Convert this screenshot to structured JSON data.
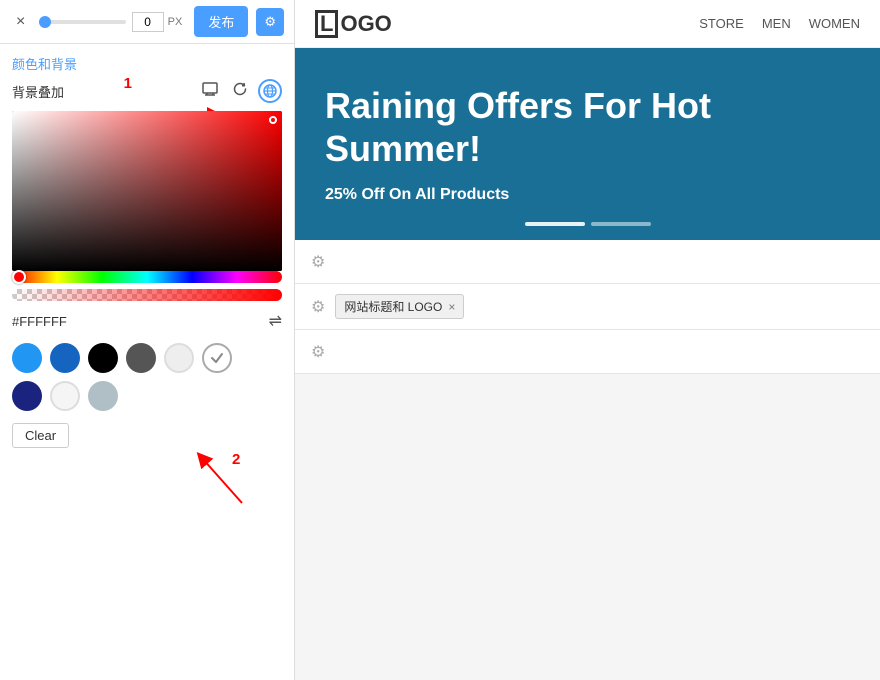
{
  "topbar": {
    "close_label": "×",
    "slider_value": "0",
    "slider_unit": "PX",
    "publish_label": "发布",
    "settings_icon": "⚙"
  },
  "left_panel": {
    "section_title": "颜色和背景",
    "bg_label": "背景叠加",
    "hex_value": "#FFFFFF",
    "clear_label": "Clear",
    "annotation1": "1",
    "annotation2": "2",
    "icons": {
      "monitor": "🖥",
      "refresh": "↺",
      "globe": "🌐"
    },
    "swatches_row1": [
      {
        "color": "#2196f3",
        "selected": false
      },
      {
        "color": "#1565c0",
        "selected": false
      },
      {
        "color": "#000000",
        "selected": false
      },
      {
        "color": "#555555",
        "selected": false
      },
      {
        "color": "#eeeeee",
        "selected": false
      },
      {
        "color": "#ffffff",
        "selected": true,
        "white": true
      }
    ],
    "swatches_row2": [
      {
        "color": "#1a237e",
        "selected": false
      },
      {
        "color": "#f5f5f5",
        "selected": false
      },
      {
        "color": "#b0bec5",
        "selected": false
      }
    ]
  },
  "right_panel": {
    "logo": "LOGO",
    "nav": [
      "STORE",
      "MEN",
      "WOMEN"
    ],
    "hero": {
      "title": "Raining Offers For Hot Summer!",
      "subtitle": "25% Off On All Products"
    },
    "component_tag": "网站标题和 LOGO",
    "close_tag": "×"
  }
}
